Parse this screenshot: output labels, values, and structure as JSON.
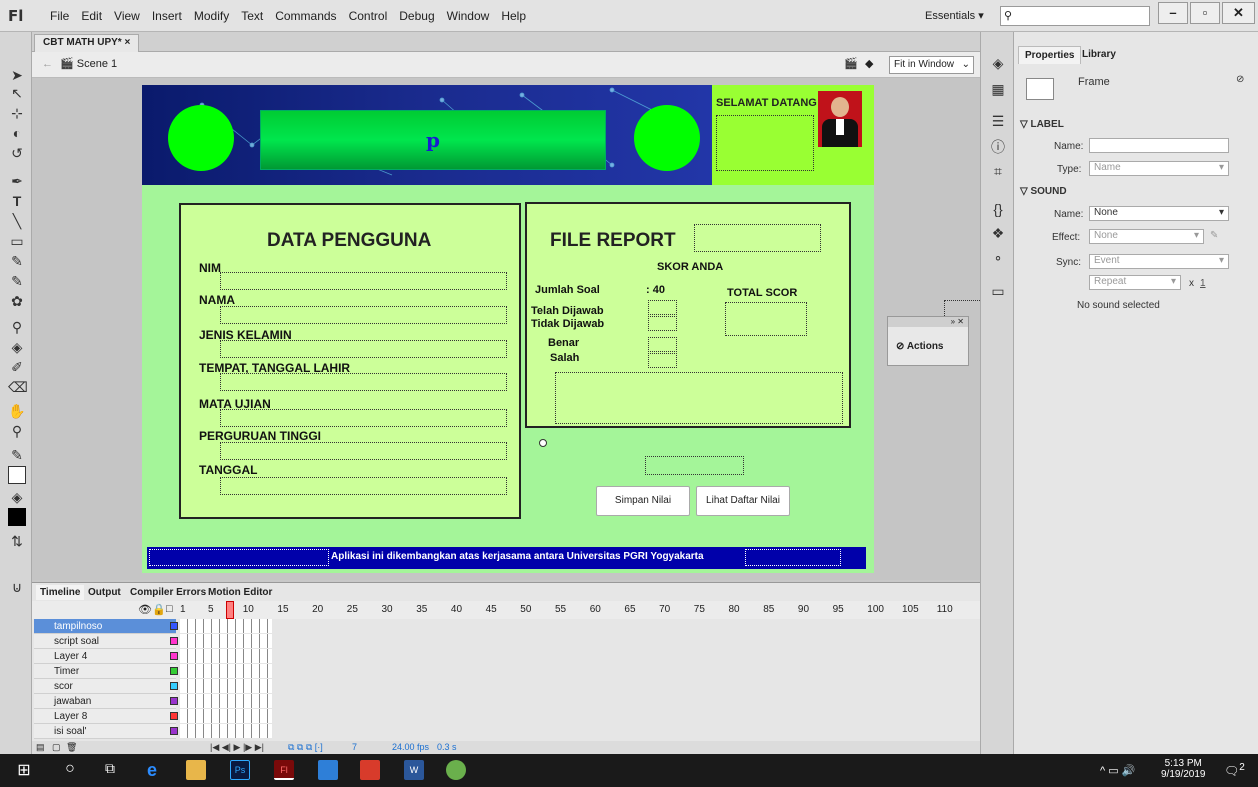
{
  "app": {
    "logo": "Fl",
    "menus": [
      "File",
      "Edit",
      "View",
      "Insert",
      "Modify",
      "Text",
      "Commands",
      "Control",
      "Debug",
      "Window",
      "Help"
    ],
    "workspace": "Essentials"
  },
  "document": {
    "tab": "CBT MATH UPY*",
    "scene": "Scene 1",
    "zoom": "Fit in Window"
  },
  "stage": {
    "banner_letter": "p",
    "welcome": "SELAMAT DATANG",
    "data_panel": {
      "title": "DATA PENGGUNA",
      "fields": [
        "NIM",
        "NAMA",
        "JENIS KELAMIN",
        "TEMPAT, TANGGAL LAHIR",
        "MATA UJIAN",
        "PERGURUAN TINGGI",
        "TANGGAL"
      ]
    },
    "report_panel": {
      "title": "FILE REPORT",
      "skor": "SKOR ANDA",
      "jumlah_label": "Jumlah Soal",
      "jumlah_value": ": 40",
      "total": "TOTAL SCOR",
      "dijawab": "Telah Dijawab",
      "tidak": "Tidak Dijawab",
      "benar": "Benar",
      "salah": "Salah"
    },
    "buttons": {
      "simpan": "Simpan Nilai",
      "lihat": "Lihat Daftar Nilai"
    },
    "footer": "Aplikasi ini dikembangkan atas kerjasama antara Universitas PGRI Yogyakarta"
  },
  "actions_panel": {
    "label": "Actions"
  },
  "properties": {
    "tabs": [
      "Properties",
      "Library"
    ],
    "type": "Frame",
    "label_section": "LABEL",
    "name_label": "Name:",
    "type_label": "Type:",
    "type_value": "Name",
    "sound_section": "SOUND",
    "sound_name_value": "None",
    "effect_label": "Effect:",
    "effect_value": "None",
    "sync_label": "Sync:",
    "sync_value": "Event",
    "repeat_value": "Repeat",
    "repeat_x": "x",
    "repeat_count": "1",
    "no_sound": "No sound selected"
  },
  "timeline": {
    "tabs": [
      "Timeline",
      "Output",
      "Compiler Errors",
      "Motion Editor"
    ],
    "frame_numbers": [
      "1",
      "5",
      "10",
      "15",
      "20",
      "25",
      "30",
      "35",
      "40",
      "45",
      "50",
      "55",
      "60",
      "65",
      "70",
      "75",
      "80",
      "85",
      "90",
      "95",
      "100",
      "105",
      "110"
    ],
    "layers": [
      {
        "name": "tampilnoso",
        "color": "#3355ff"
      },
      {
        "name": "script soal",
        "color": "#ff33cc"
      },
      {
        "name": "Layer 4",
        "color": "#ff33cc"
      },
      {
        "name": "Timer",
        "color": "#33cc33"
      },
      {
        "name": "scor",
        "color": "#33ccff"
      },
      {
        "name": "jawaban",
        "color": "#9933cc"
      },
      {
        "name": "Layer 8",
        "color": "#ff3333"
      },
      {
        "name": "isi soal'",
        "color": "#9933cc"
      }
    ],
    "current_frame": "7",
    "fps": "24.00 fps",
    "time": "0.3 s"
  },
  "taskbar": {
    "time": "5:13 PM",
    "date": "9/19/2019",
    "notification_count": "2"
  }
}
